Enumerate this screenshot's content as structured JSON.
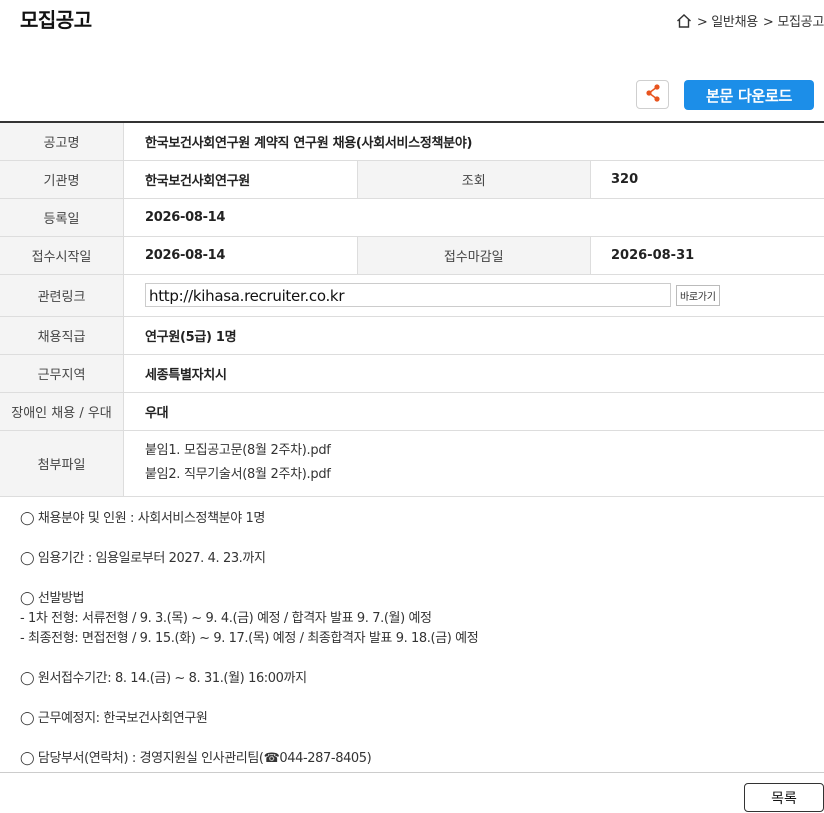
{
  "header": {
    "title": "모집공고",
    "breadcrumb": [
      "> 일반채용",
      "> 모집공고"
    ]
  },
  "toolbar": {
    "download_label": "본문 다운로드"
  },
  "info": {
    "announcement_name": {
      "label": "공고명",
      "value": "한국보건사회연구원 계약직 연구원 채용(사회서비스정책분야)"
    },
    "institution": {
      "label": "기관명",
      "value": "한국보건사회연구원"
    },
    "views": {
      "label": "조회",
      "value": "320"
    },
    "registered": {
      "label": "등록일",
      "value": "2026-08-14"
    },
    "start_date": {
      "label": "접수시작일",
      "value": "2026-08-14"
    },
    "end_date": {
      "label": "접수마감일",
      "value": "2026-08-31"
    },
    "link": {
      "label": "관련링크",
      "value": "http://kihasa.recruiter.co.kr",
      "button": "바로가기"
    },
    "grade": {
      "label": "채용직급",
      "value": "연구원(5급) 1명"
    },
    "region": {
      "label": "근무지역",
      "value": "세종특별자치시"
    },
    "disabled": {
      "label": "장애인 채용 / 우대",
      "value": "우대"
    },
    "attachments": {
      "label": "첨부파일",
      "files": [
        "붙임1. 모집공고문(8월 2주차).pdf",
        "붙임2. 직무기술서(8월 2주차).pdf"
      ]
    }
  },
  "body": {
    "lines": [
      "◯ 채용분야 및 인원 :  사회서비스정책분야 1명",
      "◯ 임용기간 : 임용일로부터 2027. 4. 23.까지",
      "◯ 선발방법",
      " - 1차 전형: 서류전형 / 9. 3.(목) ~ 9. 4.(금) 예정 / 합격자 발표 9. 7.(월) 예정",
      " - 최종전형: 면접전형 / 9. 15.(화) ~ 9. 17.(목) 예정 / 최종합격자 발표 9. 18.(금) 예정",
      "◯ 원서접수기간: 8. 14.(금) ~ 8. 31.(월) 16:00까지",
      "◯ 근무예정지: 한국보건사회연구원",
      "◯ 담당부서(연락처) : 경영지원실 인사관리팀(☎044-287-8405)"
    ]
  },
  "footer": {
    "list_label": "목록"
  },
  "colors": {
    "accent": "#1c8ee8",
    "share_icon": "#e8541e"
  }
}
